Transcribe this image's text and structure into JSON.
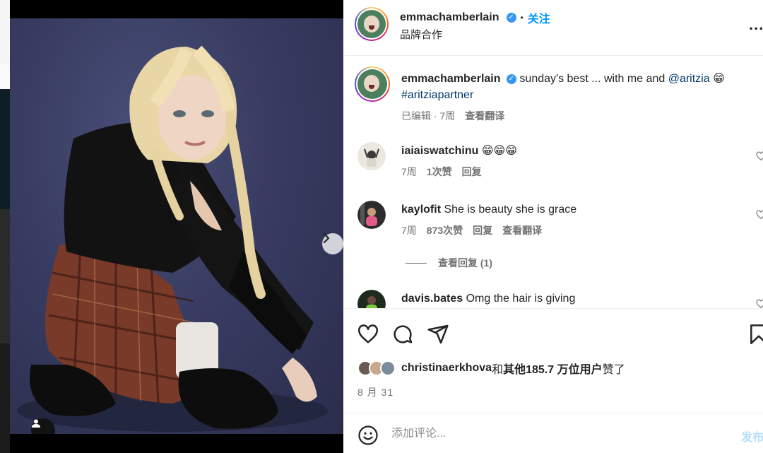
{
  "post": {
    "author": "emmachamberlain",
    "follow_label": "关注",
    "separator": "•",
    "subtitle": "品牌合作",
    "more_label": "...",
    "caption_text": "sunday's best ... with me and",
    "caption_mention": "@aritzia",
    "caption_emoji": "😁",
    "caption_hashtag": "#aritziapartner",
    "caption_meta": "已编辑 · 7周",
    "caption_translate": "查看翻译"
  },
  "comments": [
    {
      "user": "iaiaiswatchinu",
      "text": "😁😁😁",
      "time": "7周",
      "likes": "1次赞",
      "reply": "回复",
      "translate": ""
    },
    {
      "user": "kaylofit",
      "text": "She is beauty she is grace",
      "time": "7周",
      "likes": "873次赞",
      "reply": "回复",
      "translate": "查看翻译"
    },
    {
      "user": "davis.bates",
      "text": "Omg the hair is giving"
    }
  ],
  "view_replies": "查看回复 (1)",
  "likes": {
    "user": "christinaerkhova",
    "conj": "和",
    "others": "其他185.7 万位用户",
    "suffix": "赞了"
  },
  "date": "8 月 31",
  "add_comment": {
    "placeholder": "添加评论...",
    "post_label": "发布"
  },
  "carousel": {
    "count": 8,
    "active": 0
  },
  "colors": {
    "accent": "#0095f6",
    "verified": "#3897f0",
    "post_disabled": "#b2dffc"
  },
  "icons": [
    "verified-icon",
    "more-icon",
    "heart-icon",
    "comment-icon",
    "share-icon",
    "bookmark-icon",
    "emoji-icon",
    "next-icon",
    "user-tag-icon"
  ]
}
